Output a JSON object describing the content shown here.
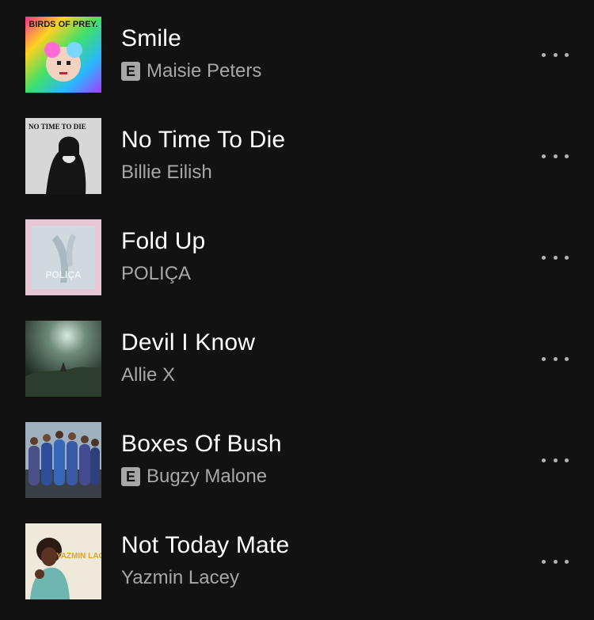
{
  "tracks": [
    {
      "title": "Smile",
      "artist": "Maisie Peters",
      "explicit": true,
      "explicit_label": "E",
      "art_text": "BIRDS OF PREY."
    },
    {
      "title": "No Time To Die",
      "artist": "Billie Eilish",
      "explicit": false,
      "art_text": "NO TIME TO DIE"
    },
    {
      "title": "Fold Up",
      "artist": "POLIÇA",
      "explicit": false,
      "art_text": "POLIÇA"
    },
    {
      "title": "Devil I Know",
      "artist": "Allie X",
      "explicit": false
    },
    {
      "title": "Boxes Of Bush",
      "artist": "Bugzy Malone",
      "explicit": true,
      "explicit_label": "E"
    },
    {
      "title": "Not Today Mate",
      "artist": "Yazmin Lacey",
      "explicit": false,
      "art_text": "YAZMIN LACEY"
    }
  ],
  "colors": {
    "background": "#121212",
    "title": "#ffffff",
    "subtitle": "#a7a7a7"
  },
  "icons": {
    "more": "more-options-icon",
    "explicit": "explicit-badge"
  }
}
